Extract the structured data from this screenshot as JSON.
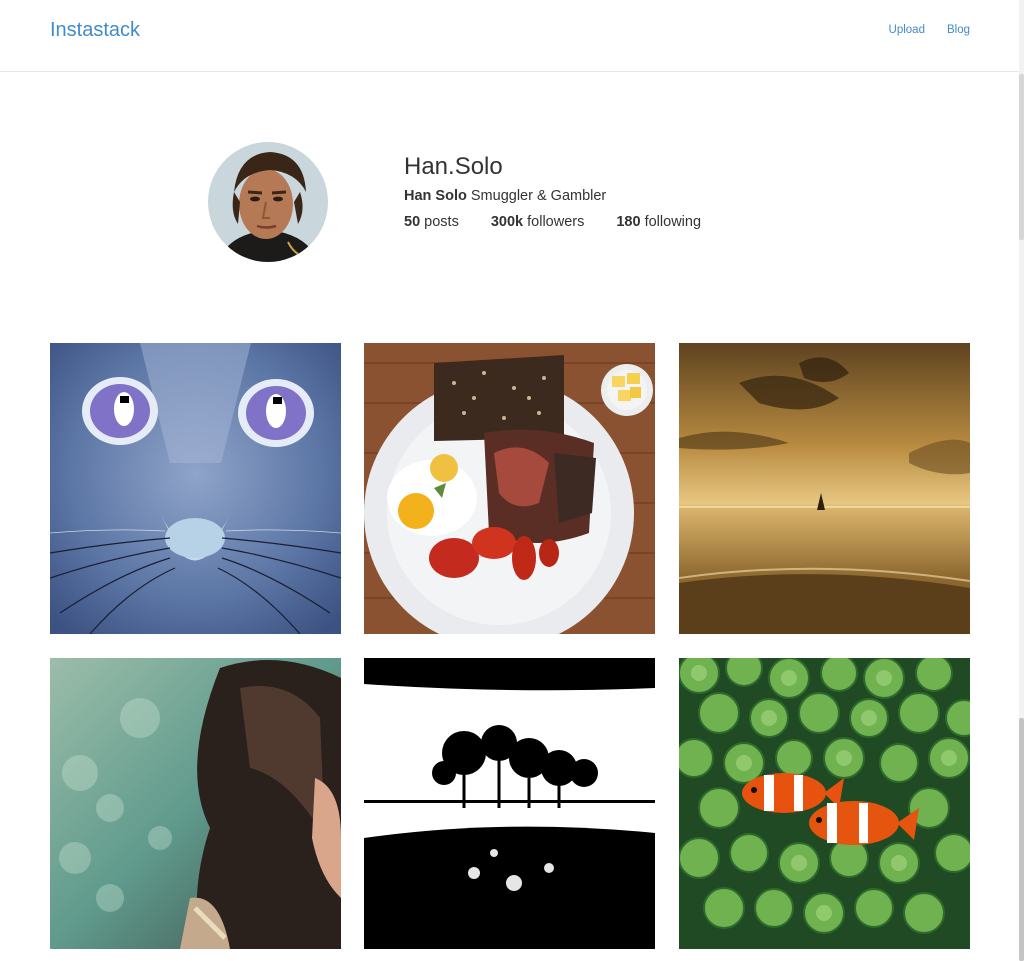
{
  "navbar": {
    "brand": "Instastack",
    "links": [
      "Upload",
      "Blog"
    ]
  },
  "profile": {
    "username": "Han.Solo",
    "full_name": "Han Solo",
    "bio": "Smuggler & Gambler",
    "stats": [
      {
        "value": "50",
        "label": "posts"
      },
      {
        "value": "300k",
        "label": "followers"
      },
      {
        "value": "180",
        "label": "following"
      }
    ]
  },
  "colors": {
    "link": "#428bca",
    "text": "#333333",
    "border": "#e7e7e7"
  }
}
